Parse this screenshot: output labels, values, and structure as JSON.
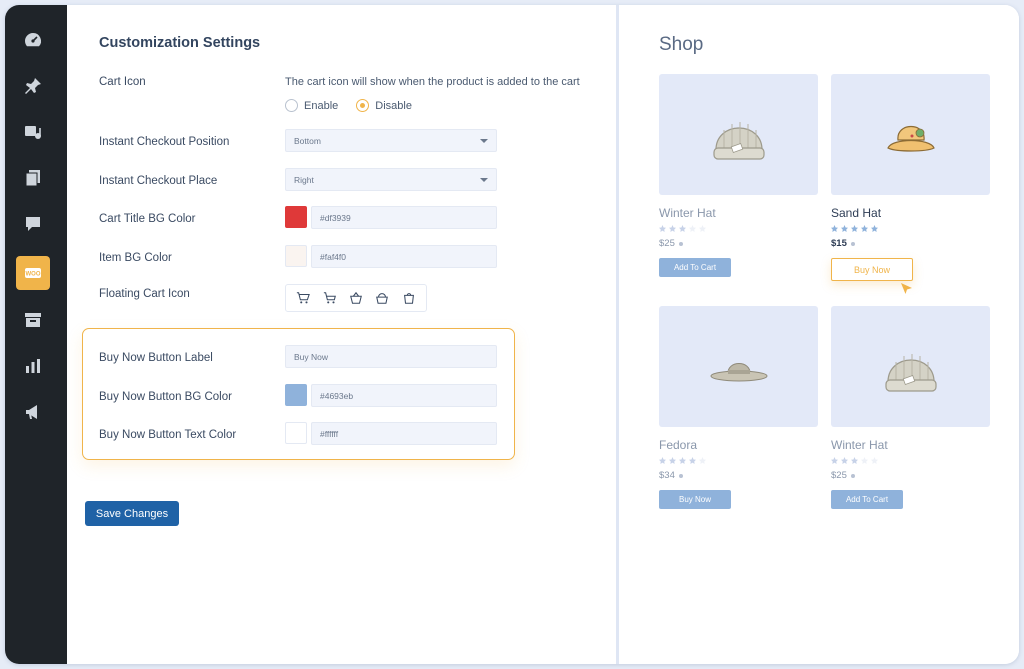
{
  "settings": {
    "title": "Customization Settings",
    "cart_icon": {
      "label": "Cart Icon",
      "hint": "The cart icon will show when the product is added to the cart",
      "options": [
        "Enable",
        "Disable"
      ],
      "selected": "Disable"
    },
    "checkout_position": {
      "label": "Instant Checkout Position",
      "value": "Bottom"
    },
    "checkout_place": {
      "label": "Instant Checkout Place",
      "value": "Right"
    },
    "cart_title_bg": {
      "label": "Cart Title BG Color",
      "value": "#df3939",
      "swatch": "#df3939"
    },
    "item_bg": {
      "label": "Item BG Color",
      "value": "#faf4f0",
      "swatch": "#faf4f0"
    },
    "floating_cart": {
      "label": "Floating Cart Icon"
    },
    "buy_now_label": {
      "label": "Buy Now Button Label",
      "value": "Buy Now"
    },
    "buy_now_bg": {
      "label": "Buy Now Button BG Color",
      "value": "#4693eb",
      "swatch": "#8fb2db"
    },
    "buy_now_text": {
      "label": "Buy Now Button Text Color",
      "value": "#ffffff",
      "swatch": "#ffffff"
    },
    "save_label": "Save Changes"
  },
  "shop": {
    "title": "Shop",
    "products": [
      {
        "name": "Winter Hat",
        "price": "$25",
        "button": "Add To Cart",
        "rating": 3
      },
      {
        "name": "Sand Hat",
        "price": "$15",
        "button": "Buy Now",
        "rating": 5
      },
      {
        "name": "Fedora",
        "price": "$34",
        "button": "Buy Now",
        "rating": 4
      },
      {
        "name": "Winter Hat",
        "price": "$25",
        "button": "Add To Cart",
        "rating": 3
      }
    ]
  },
  "colors": {
    "accent": "#f0b44a",
    "primary": "#1f62a6",
    "sidebar": "#1f2429"
  },
  "sidebar_icons": [
    "dashboard-icon",
    "pin-icon",
    "media-icon",
    "pages-icon",
    "comments-icon",
    "woo-icon",
    "archive-icon",
    "analytics-icon",
    "marketing-icon"
  ]
}
